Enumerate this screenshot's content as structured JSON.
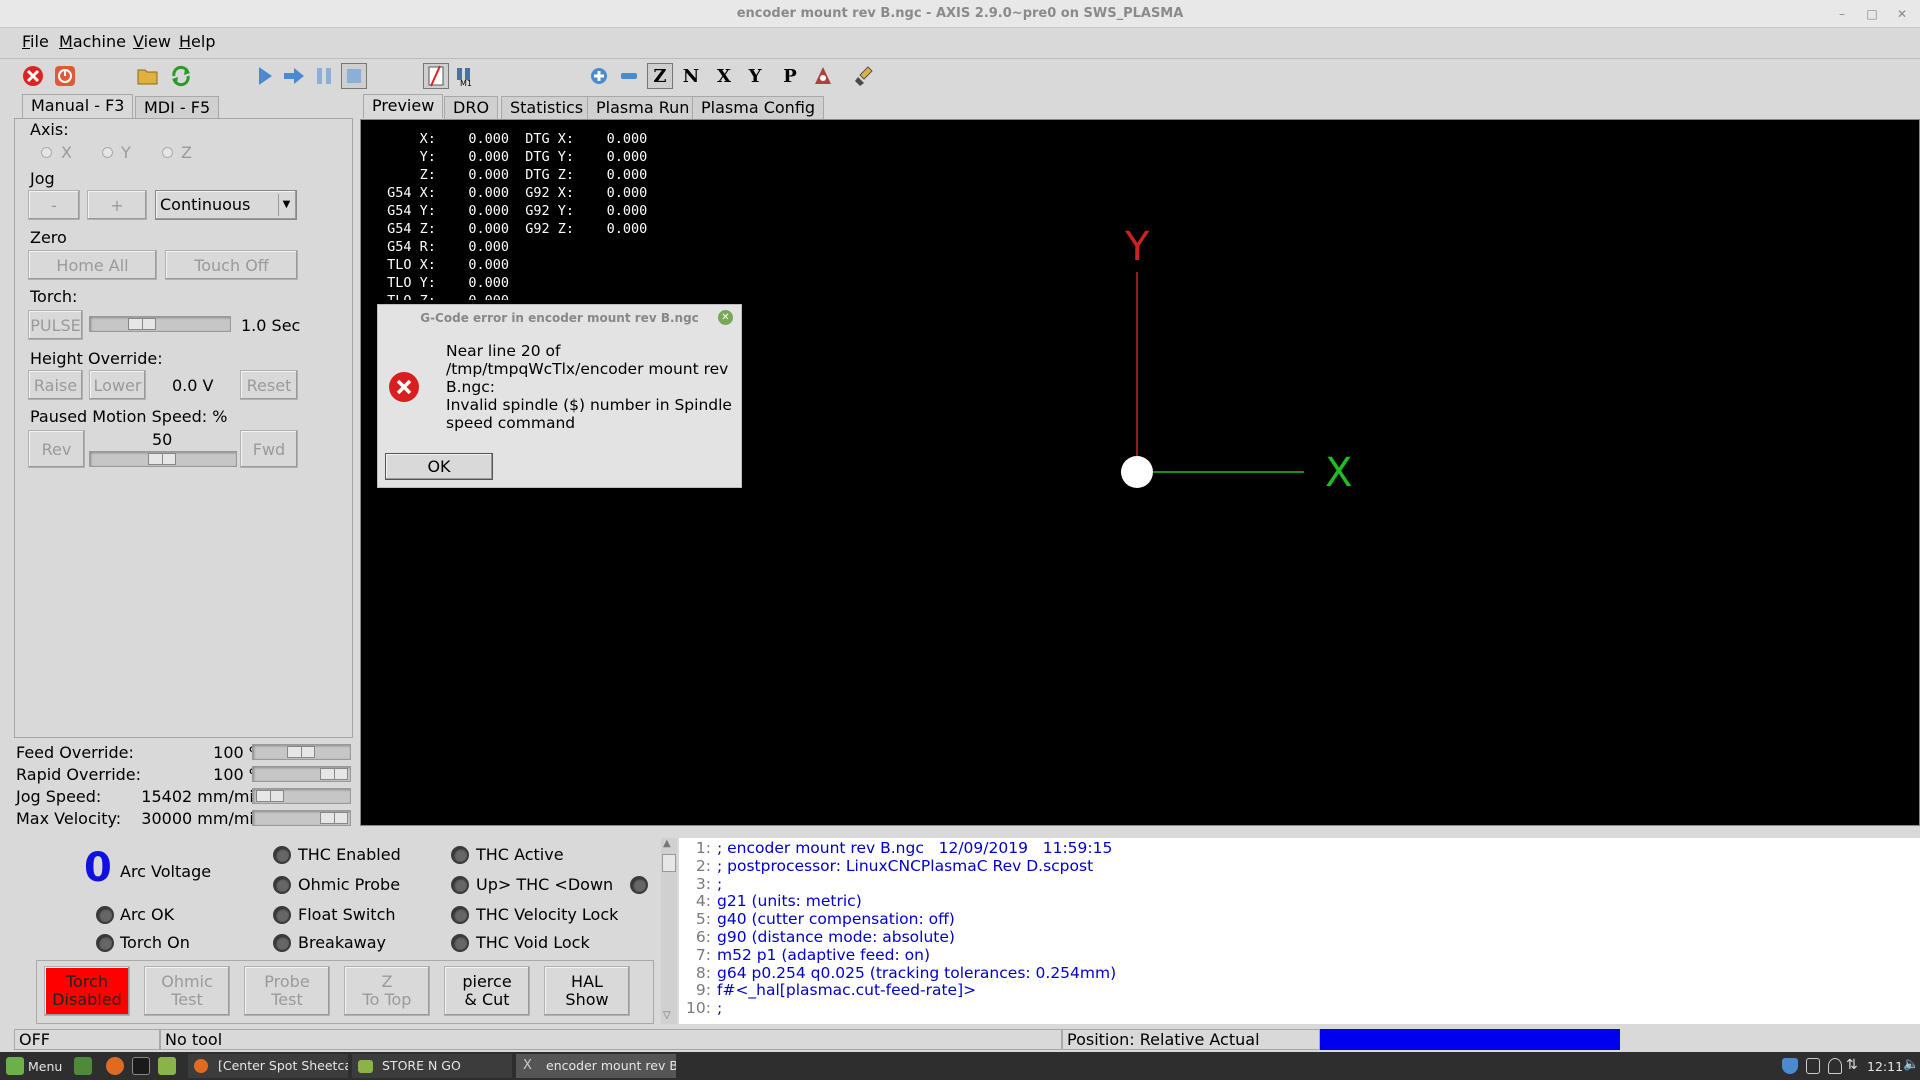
{
  "window": {
    "title": "encoder mount rev B.ngc - AXIS 2.9.0~pre0 on SWS_PLASMA"
  },
  "menu": [
    "File",
    "Machine",
    "View",
    "Help"
  ],
  "left_tabs": [
    "Manual - F3",
    "MDI - F5"
  ],
  "right_tabs": [
    "Preview",
    "DRO",
    "Statistics",
    "Plasma Run",
    "Plasma Config"
  ],
  "manual": {
    "axis_label": "Axis:",
    "axes": [
      "X",
      "Y",
      "Z"
    ],
    "jog_label": "Jog",
    "jog_minus": "-",
    "jog_plus": "+",
    "jog_mode": "Continuous",
    "zero_label": "Zero",
    "home_all": "Home All",
    "touch_off": "Touch Off",
    "torch_label": "Torch:",
    "pulse": "PULSE",
    "pulse_time": "1.0 Sec",
    "height_override_label": "Height Override:",
    "raise": "Raise",
    "lower": "Lower",
    "height_value": "0.0 V",
    "reset": "Reset",
    "paused_label": "Paused Motion Speed: %",
    "paused_value": "50",
    "paused_level": 0.5,
    "rev": "Rev",
    "fwd": "Fwd"
  },
  "overrides": [
    {
      "label": "Feed Override:",
      "value": "100 %",
      "level": 0.5
    },
    {
      "label": "Rapid Override:",
      "value": "100 %",
      "level": 1.0
    },
    {
      "label": "Jog Speed:",
      "value": "15402 mm/min",
      "level": 0.05
    },
    {
      "label": "Max Velocity:",
      "value": "30000 mm/min",
      "level": 1.0
    }
  ],
  "dro": [
    "     X:    0.000  DTG X:    0.000",
    "     Y:    0.000  DTG Y:    0.000",
    "     Z:    0.000  DTG Z:    0.000",
    " G54 X:    0.000  G92 X:    0.000",
    " G54 Y:    0.000  G92 Y:    0.000",
    " G54 Z:    0.000  G92 Z:    0.000",
    " G54 R:    0.000",
    " TLO X:    0.000",
    " TLO Y:    0.000",
    " TLO Z:    0.000"
  ],
  "preview": {
    "x_axis_label": "X",
    "y_axis_label": "Y",
    "x_color": "#22bb22",
    "y_color": "#cc2222"
  },
  "dialog": {
    "title": "G-Code error in encoder mount rev B.ngc",
    "message": "Near line 20 of\n/tmp/tmpqWcTlx/encoder mount rev\nB.ngc:\nInvalid spindle ($) number in Spindle\nspeed command",
    "ok": "OK"
  },
  "plasma": {
    "arc_voltage_value": "0",
    "arc_voltage_label": "Arc Voltage",
    "arc_ok": "Arc OK",
    "torch_on": "Torch On",
    "thc_enabled": "THC Enabled",
    "ohmic_probe": "Ohmic Probe",
    "float_switch": "Float Switch",
    "breakaway": "Breakaway",
    "thc_active": "THC Active",
    "thc_updown": "Up> THC <Down",
    "thc_velocity_lock": "THC Velocity Lock",
    "thc_void_lock": "THC Void Lock",
    "buttons": [
      "Torch\nDisabled",
      "Ohmic\nTest",
      "Probe\nTest",
      "Z\nTo Top",
      "pierce\n& Cut",
      "HAL\nShow"
    ],
    "torch_color": "#ff0000"
  },
  "gcode_lines": [
    {
      "num": "1:",
      "text": "; encoder mount rev B.ngc   12/09/2019   11:59:15"
    },
    {
      "num": "2:",
      "text": "; postprocessor: LinuxCNCPlasmaC Rev D.scpost"
    },
    {
      "num": "3:",
      "text": ";"
    },
    {
      "num": "4:",
      "text": "g21 (units: metric)"
    },
    {
      "num": "5:",
      "text": "g40 (cutter compensation: off)"
    },
    {
      "num": "6:",
      "text": "g90 (distance mode: absolute)"
    },
    {
      "num": "7:",
      "text": "m52 p1 (adaptive feed: on)"
    },
    {
      "num": "8:",
      "text": "g64 p0.254 q0.025 (tracking tolerances: 0.254mm)"
    },
    {
      "num": "9:",
      "text": "f#<_hal[plasmac.cut-feed-rate]>"
    },
    {
      "num": "10:",
      "text": ";"
    }
  ],
  "status": {
    "state": "OFF",
    "tool": "No tool",
    "position": "Position: Relative Actual",
    "progress_color": "#0000ee"
  },
  "taskbar": {
    "menu": "Menu",
    "tasks": [
      "[Center Spot Sheetca...",
      "STORE N GO",
      "encoder mount rev B..."
    ],
    "clock": "12:11"
  }
}
